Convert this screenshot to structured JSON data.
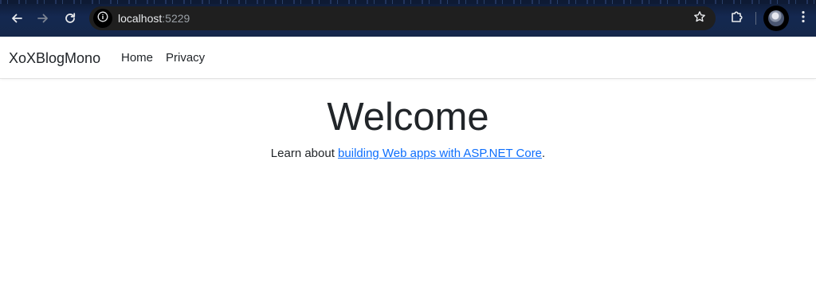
{
  "browser": {
    "url_host": "localhost",
    "url_port": ":5229",
    "icons": {
      "back": "arrow-left-icon",
      "forward": "arrow-right-icon",
      "reload": "reload-icon",
      "site_info": "info-icon",
      "bookmark": "star-icon",
      "extensions": "puzzle-icon",
      "menu": "kebab-menu-icon"
    },
    "colors": {
      "toolbar": "#142850",
      "omnibox": "#1f1f1f",
      "text": "#e8eaed"
    }
  },
  "navbar": {
    "brand": "XoXBlogMono",
    "links": [
      {
        "label": "Home"
      },
      {
        "label": "Privacy"
      }
    ]
  },
  "main": {
    "title": "Welcome",
    "lead_prefix": "Learn about ",
    "lead_link": "building Web apps with ASP.NET Core",
    "lead_suffix": ".",
    "link_color": "#0d6efd"
  }
}
